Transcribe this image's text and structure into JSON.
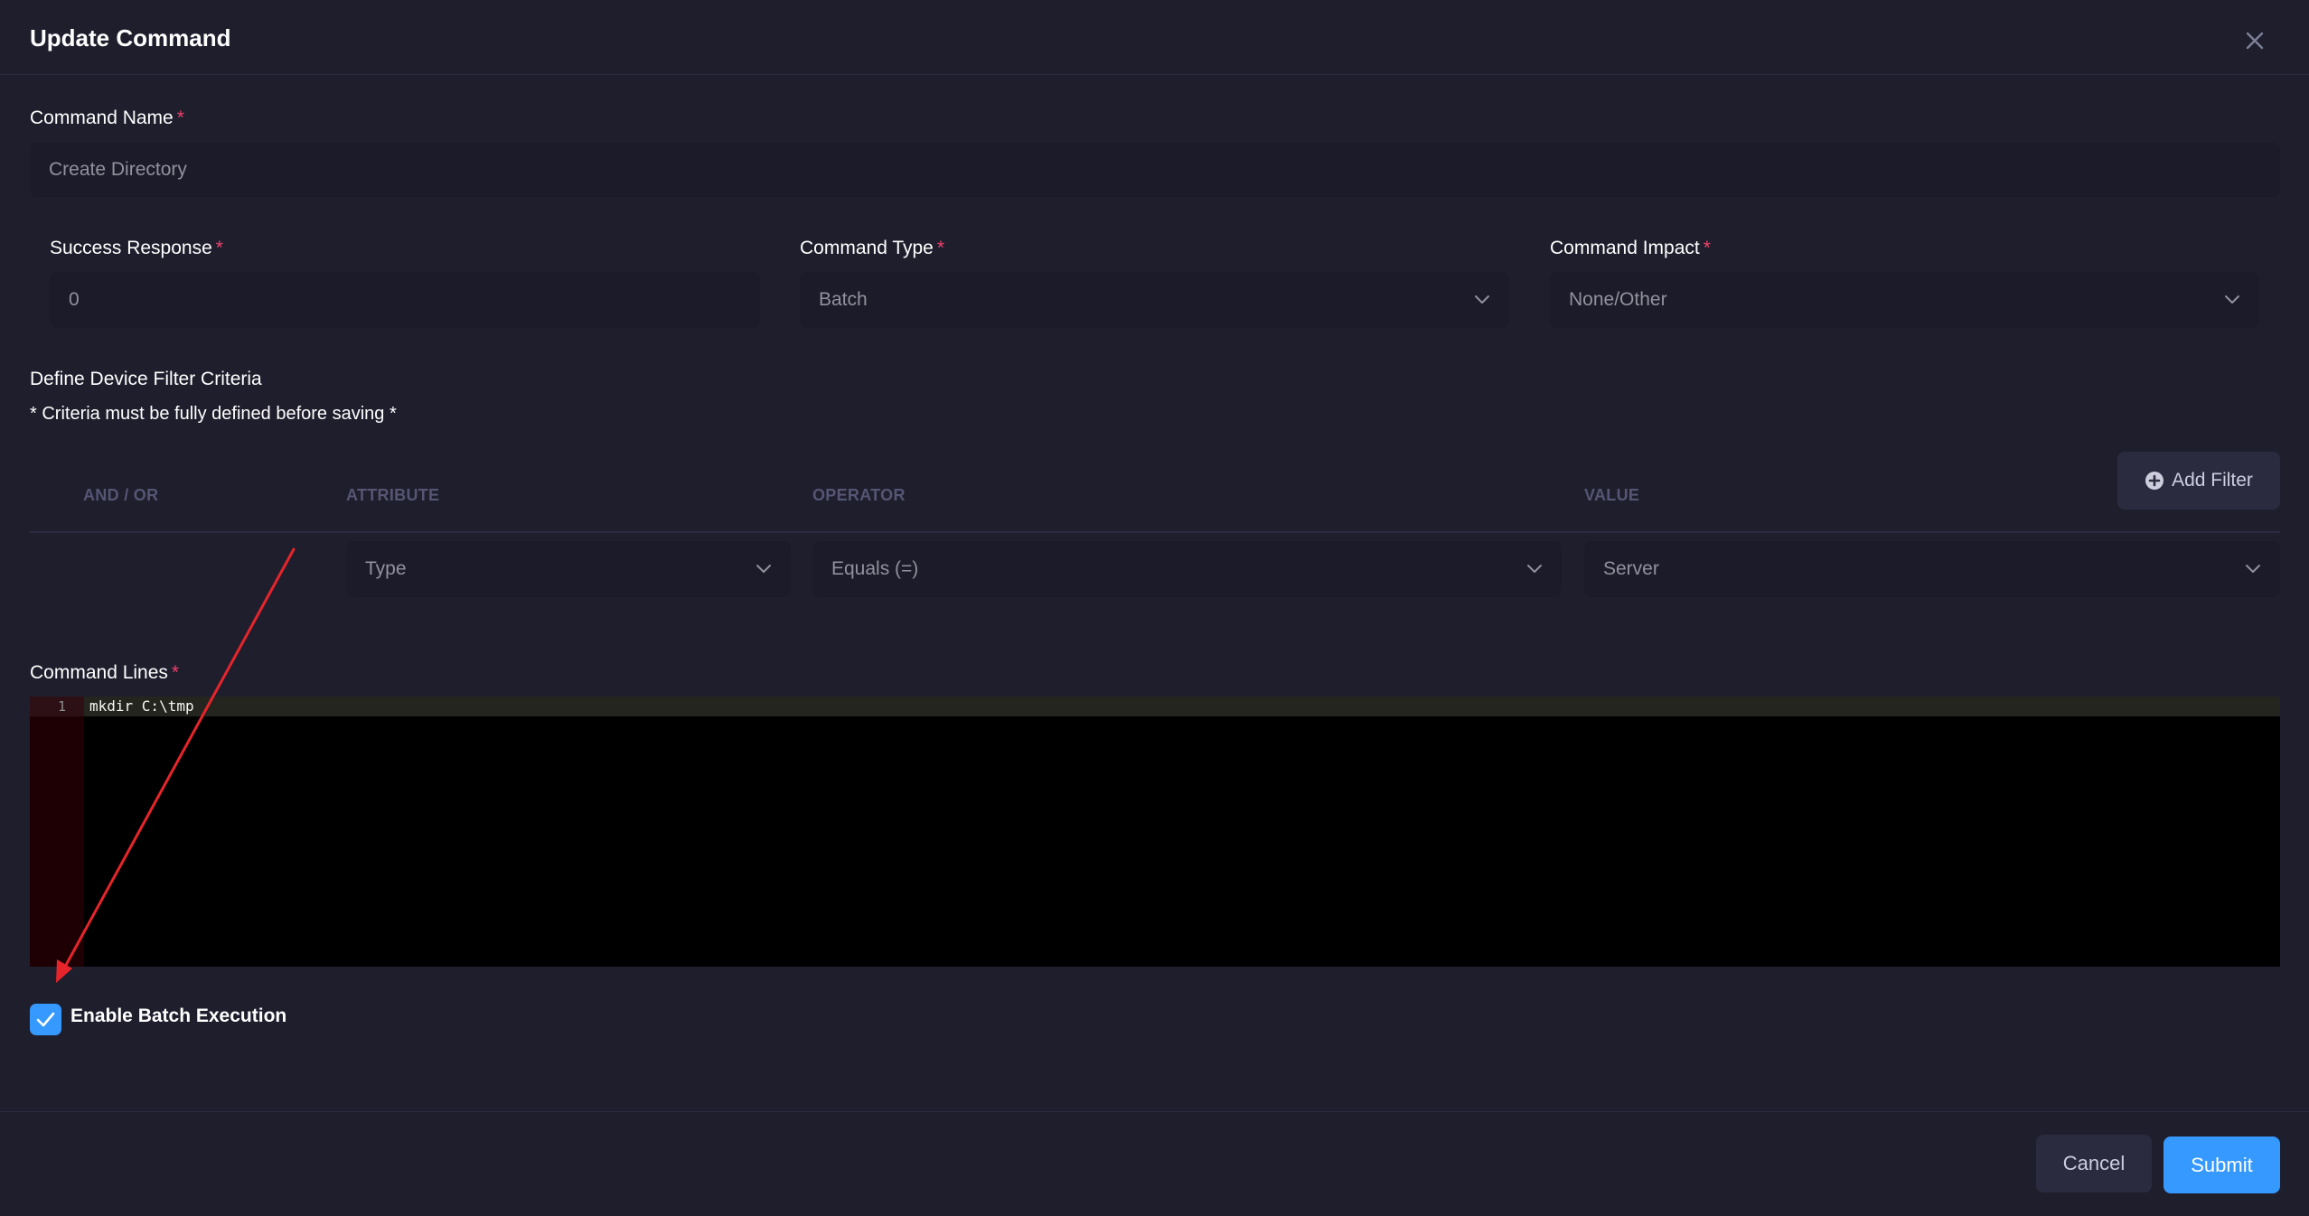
{
  "modal": {
    "title": "Update Command"
  },
  "command_name": {
    "label": "Command Name",
    "required_mark": "*",
    "value": "Create Directory"
  },
  "success_response": {
    "label": "Success Response",
    "required_mark": "*",
    "value": "0"
  },
  "command_type": {
    "label": "Command Type",
    "required_mark": "*",
    "value": "Batch"
  },
  "command_impact": {
    "label": "Command Impact",
    "required_mark": "*",
    "value": "None/Other"
  },
  "filter": {
    "title": "Define Device Filter Criteria",
    "note": "* Criteria must be fully defined before saving *",
    "add_button_label": "Add Filter",
    "columns": {
      "and_or": "AND / OR",
      "attribute": "ATTRIBUTE",
      "operator": "OPERATOR",
      "value": "VALUE"
    },
    "rows": [
      {
        "attribute": "Type",
        "operator": "Equals (=)",
        "value": "Server"
      }
    ]
  },
  "command_lines": {
    "label": "Command Lines",
    "required_mark": "*",
    "lines": [
      {
        "number": "1",
        "text": "mkdir C:\\tmp"
      }
    ]
  },
  "batch_execution": {
    "label": "Enable Batch Execution",
    "checked": true
  },
  "footer": {
    "cancel_label": "Cancel",
    "submit_label": "Submit"
  },
  "colors": {
    "accent": "#3699ff",
    "required": "#f1416c",
    "annotation_arrow": "#e8242b",
    "background": "#1e1e2d"
  }
}
